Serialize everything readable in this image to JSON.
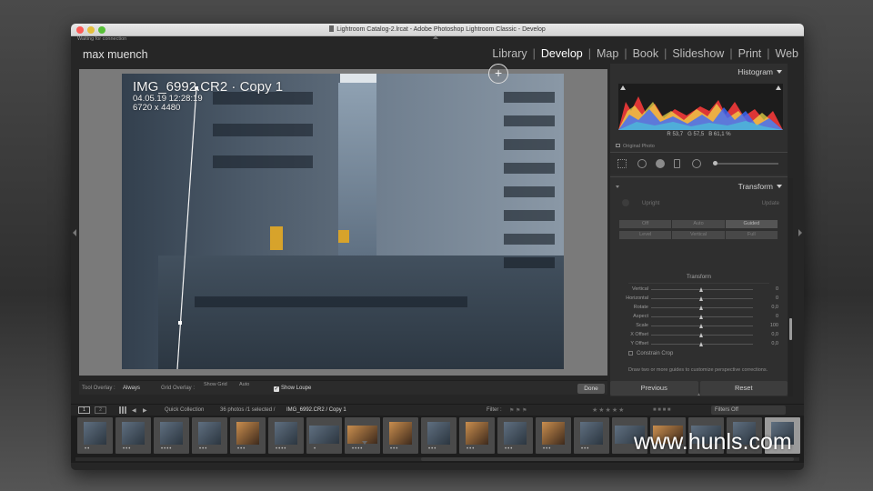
{
  "window": {
    "title": "Lightroom Catalog-2.lrcat - Adobe Photoshop Lightroom Classic - Develop",
    "status": "Waiting for connection"
  },
  "identity_plate": "max muench",
  "modules": [
    {
      "label": "Library",
      "active": false
    },
    {
      "label": "Develop",
      "active": true
    },
    {
      "label": "Map",
      "active": false
    },
    {
      "label": "Book",
      "active": false
    },
    {
      "label": "Slideshow",
      "active": false
    },
    {
      "label": "Print",
      "active": false
    },
    {
      "label": "Web",
      "active": false
    }
  ],
  "photo_info": {
    "name": "IMG_6992.CR2",
    "copy": "Copy 1",
    "datetime": "04.05.19 12:28:19",
    "dimensions": "6720 x 4480"
  },
  "toolbar": {
    "tool_overlay_label": "Tool Overlay :",
    "tool_overlay_value": "Always",
    "grid_overlay_label": "Grid Overlay :",
    "show_grid_label": "Show Grid",
    "show_grid_value": "Auto",
    "show_loupe_label": "Show Loupe",
    "show_loupe_checked": "✓",
    "done_label": "Done"
  },
  "histogram": {
    "title": "Histogram",
    "r_label": "R",
    "r_value": "53,7",
    "g_label": "G",
    "g_value": "57,5",
    "b_label": "B",
    "b_value": "61,1",
    "unit": "%",
    "original_photo_label": "Original Photo"
  },
  "transform": {
    "title": "Transform",
    "upright_label": "Upright",
    "update_label": "Update",
    "upright_modes_row1": [
      "Off",
      "Auto",
      "Guided"
    ],
    "upright_modes_row2": [
      "Level",
      "Vertical",
      "Full"
    ],
    "active_mode": "Guided",
    "section_label": "Transform",
    "sliders": [
      {
        "label": "Vertical",
        "value": "0"
      },
      {
        "label": "Horizontal",
        "value": "0"
      },
      {
        "label": "Rotate",
        "value": "0,0"
      },
      {
        "label": "Aspect",
        "value": "0"
      },
      {
        "label": "Scale",
        "value": "100"
      },
      {
        "label": "X Offset",
        "value": "0,0"
      },
      {
        "label": "Y Offset",
        "value": "0,0"
      }
    ],
    "constrain_crop_label": "Constrain Crop",
    "hint": "Draw two or more guides to customize perspective corrections."
  },
  "panel_buttons": {
    "previous": "Previous",
    "reset": "Reset"
  },
  "filmstrip_bar": {
    "monitor1": "1",
    "monitor2": "2",
    "source": "Quick Collection",
    "count": "36 photos /1 selected /",
    "current": "IMG_6992.CR2 / Copy 1",
    "filter_label": "Filter :",
    "filters_value": "Filters Off"
  },
  "watermark": "www.hunls.com",
  "colors": {
    "panel_bg": "#2f2f2f",
    "active_module": "#ffffff",
    "histogram_red": "#ff3b3b",
    "histogram_blue": "#3a6bff",
    "histogram_yellow": "#f2e34a"
  }
}
